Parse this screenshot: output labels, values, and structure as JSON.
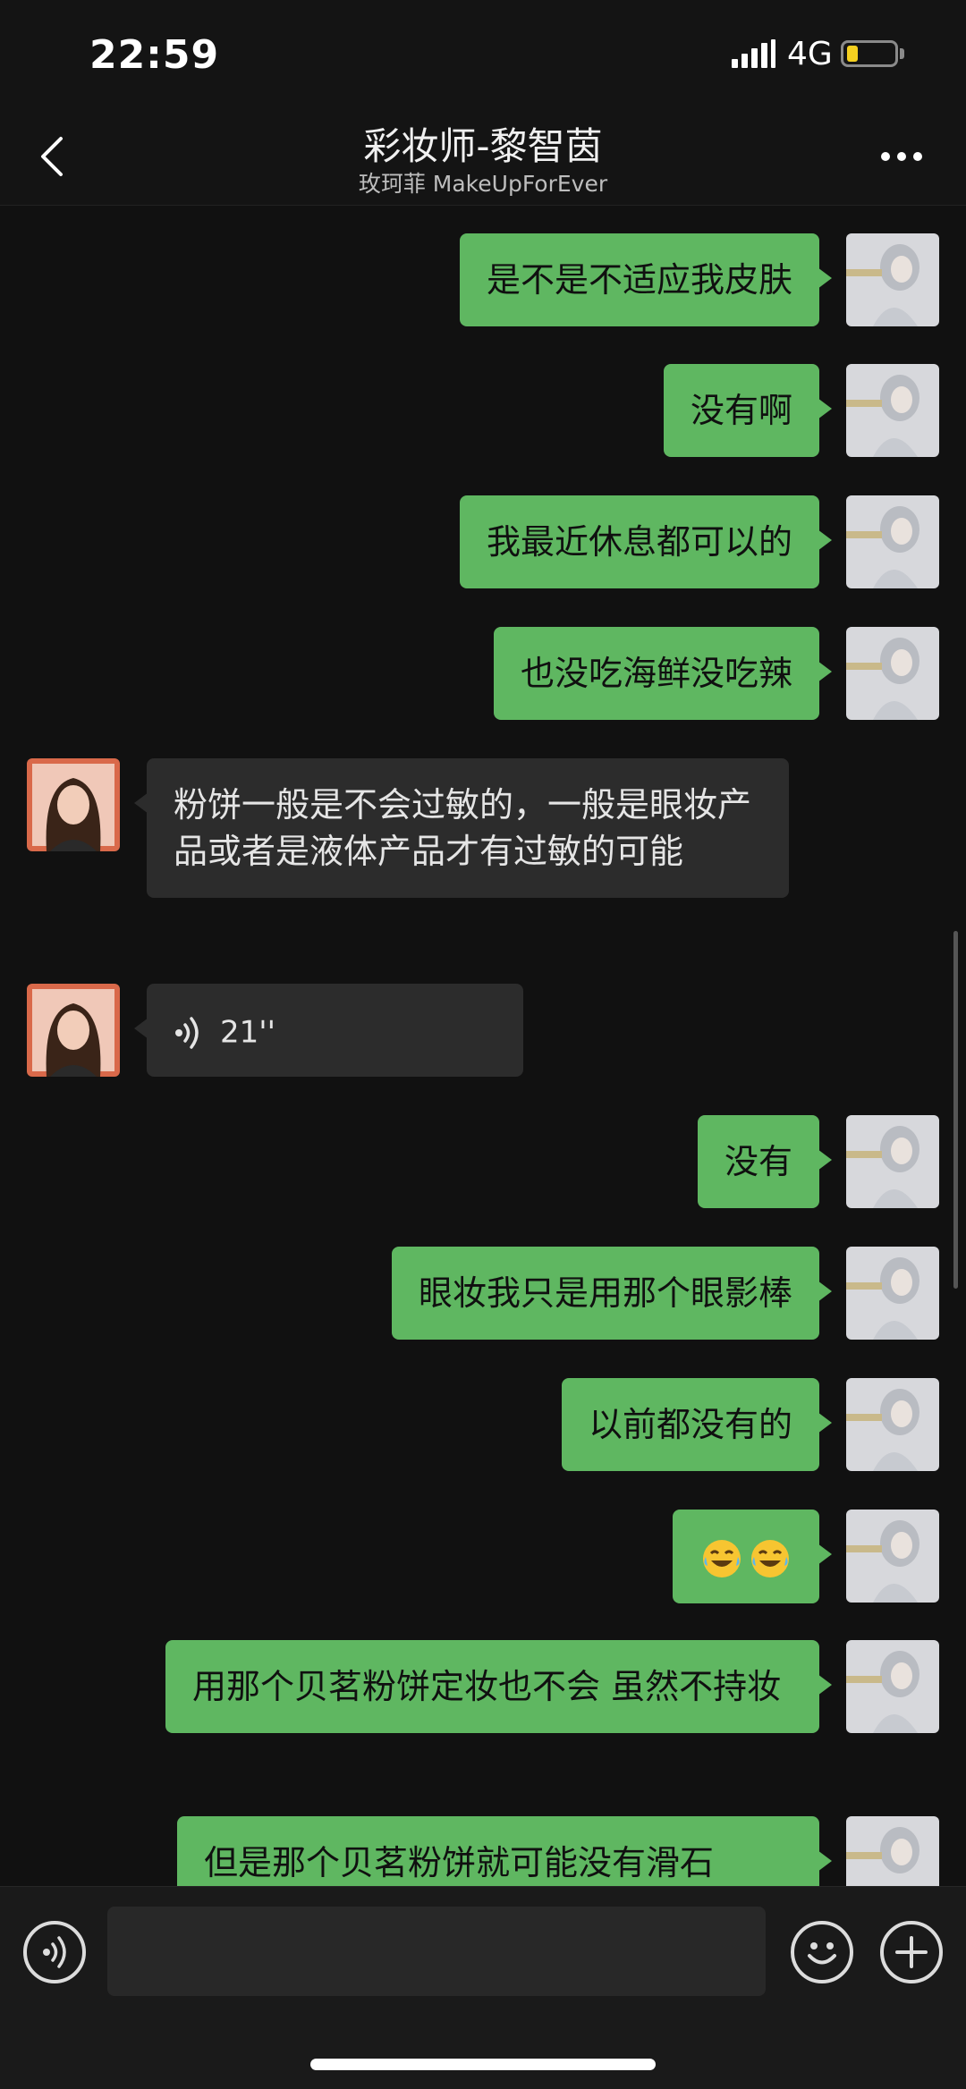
{
  "status_bar": {
    "time": "22:59",
    "network": "4G",
    "battery_level": 0.15
  },
  "nav": {
    "title": "彩妆师-黎智茵",
    "subtitle": "玫珂菲 MakeUpForEver"
  },
  "messages": [
    {
      "sender": "me",
      "text": "是不是不适应我皮肤"
    },
    {
      "sender": "me",
      "text": "没有啊"
    },
    {
      "sender": "me",
      "text": "我最近休息都可以的"
    },
    {
      "sender": "me",
      "text": "也没吃海鲜没吃辣"
    },
    {
      "sender": "them",
      "text": "粉饼一般是不会过敏的，一般是眼妆产品或者是液体产品才有过敏的可能"
    },
    {
      "sender": "them",
      "type": "voice",
      "duration": "21''"
    },
    {
      "sender": "me",
      "text": "没有"
    },
    {
      "sender": "me",
      "text": "眼妆我只是用那个眼影棒"
    },
    {
      "sender": "me",
      "text": "以前都没有的"
    },
    {
      "sender": "me",
      "type": "emoji",
      "emojis": [
        "laugh-cry-emoji",
        "laugh-cry-emoji"
      ]
    },
    {
      "sender": "me",
      "text": "用那个贝茗粉饼定妆也不会 虽然不持妆"
    },
    {
      "sender": "me",
      "text": "但是那个贝茗粉饼就可能没有滑石"
    }
  ],
  "input": {
    "placeholder": "",
    "value": ""
  },
  "colors": {
    "my_bubble": "#5fb761",
    "their_bubble": "#2c2c2c",
    "background": "#111111"
  }
}
